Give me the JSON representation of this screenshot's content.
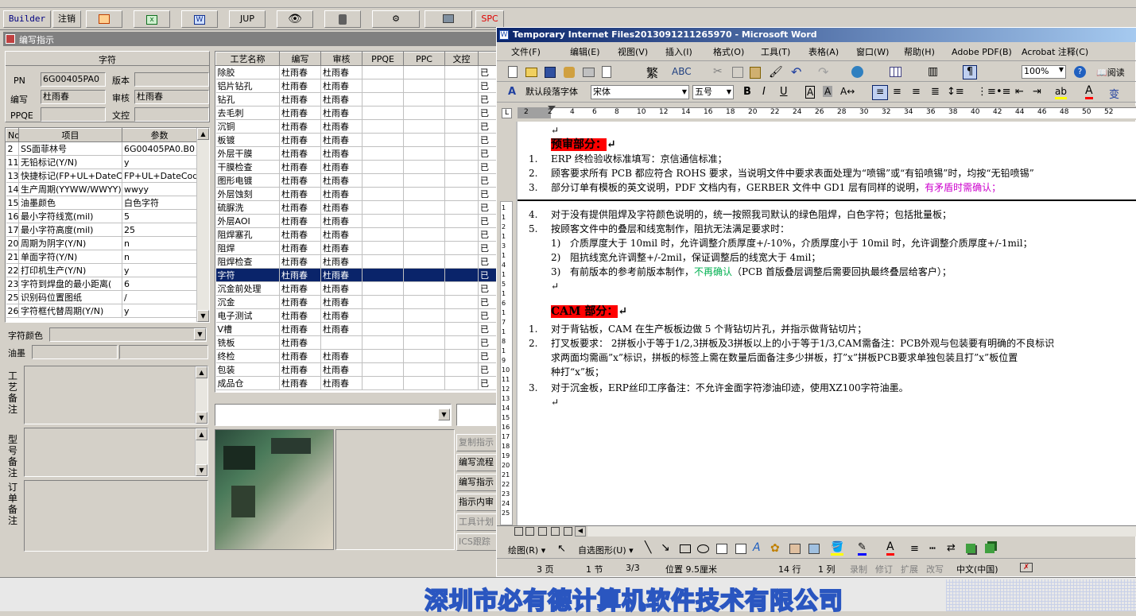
{
  "toolbar": {
    "builder": "Builder",
    "logout": "注销",
    "jup": "JUP",
    "spc": "SPC"
  },
  "panel": {
    "title": "编写指示",
    "section": "字符",
    "pn_label": "PN",
    "pn_value": "6G00405PA0",
    "version_label": "版本",
    "version_value": "",
    "author_label": "编写",
    "author_value": "杜雨春",
    "reviewer_label": "审核",
    "reviewer_value": "杜雨春",
    "ppqe_label": "PPQE",
    "ppqe_value": "",
    "doc_label": "文控",
    "doc_value": ""
  },
  "params": {
    "headers": [
      "No",
      "项目",
      "参数"
    ],
    "rows": [
      [
        "2",
        "SS面菲林号",
        "6G00405PA0.B0"
      ],
      [
        "11",
        "无铅标记(Y/N)",
        "y"
      ],
      [
        "13",
        "快捷标记(FP+UL+DateCo",
        "FP+UL+DateCode"
      ],
      [
        "14",
        "生产周期(YYWW/WWYY)",
        "wwyy"
      ],
      [
        "15",
        "油墨颜色",
        "白色字符"
      ],
      [
        "16",
        "最小字符线宽(mil)",
        "5"
      ],
      [
        "17",
        "最小字符高度(mil)",
        "25"
      ],
      [
        "20",
        "周期为阴字(Y/N)",
        "n"
      ],
      [
        "21",
        "单面字符(Y/N)",
        "n"
      ],
      [
        "22",
        "打印机生产(Y/N)",
        "y"
      ],
      [
        "23",
        "字符到焊盘的最小距离(",
        "6"
      ],
      [
        "25",
        "识别码位置图纸",
        "/"
      ],
      [
        "26",
        "字符框代替周期(Y/N)",
        "y"
      ]
    ]
  },
  "left_fields": {
    "color_label": "字符颜色",
    "ink_label": "油墨",
    "process_note": "工艺备注",
    "model_note": "型号备注",
    "order_note": "订单备注"
  },
  "processes": {
    "headers": [
      "工艺名称",
      "编写",
      "审核",
      "PPQE",
      "PPC",
      "文控"
    ],
    "rows": [
      [
        "除胶",
        "杜雨春",
        "杜雨春",
        "已"
      ],
      [
        "铝片钻孔",
        "杜雨春",
        "杜雨春",
        "已"
      ],
      [
        "钻孔",
        "杜雨春",
        "杜雨春",
        "已"
      ],
      [
        "去毛刺",
        "杜雨春",
        "杜雨春",
        "已"
      ],
      [
        "沉铜",
        "杜雨春",
        "杜雨春",
        "已"
      ],
      [
        "板镀",
        "杜雨春",
        "杜雨春",
        "已"
      ],
      [
        "外层干膜",
        "杜雨春",
        "杜雨春",
        "已"
      ],
      [
        "干膜检查",
        "杜雨春",
        "杜雨春",
        "已"
      ],
      [
        "图形电镀",
        "杜雨春",
        "杜雨春",
        "已"
      ],
      [
        "外层蚀刻",
        "杜雨春",
        "杜雨春",
        "已"
      ],
      [
        "硫脲洗",
        "杜雨春",
        "杜雨春",
        "已"
      ],
      [
        "外层AOI",
        "杜雨春",
        "杜雨春",
        "已"
      ],
      [
        "阻焊塞孔",
        "杜雨春",
        "杜雨春",
        "已"
      ],
      [
        "阻焊",
        "杜雨春",
        "杜雨春",
        "已"
      ],
      [
        "阻焊检查",
        "杜雨春",
        "杜雨春",
        "已"
      ],
      [
        "字符",
        "杜雨春",
        "杜雨春",
        "已"
      ],
      [
        "沉金前处理",
        "杜雨春",
        "杜雨春",
        "已"
      ],
      [
        "沉金",
        "杜雨春",
        "杜雨春",
        "已"
      ],
      [
        "电子测试",
        "杜雨春",
        "杜雨春",
        "已"
      ],
      [
        "V槽",
        "杜雨春",
        "杜雨春",
        "已"
      ],
      [
        "铣板",
        "杜雨春",
        "",
        "已"
      ],
      [
        "终检",
        "杜雨春",
        "杜雨春",
        "已"
      ],
      [
        "包装",
        "杜雨春",
        "杜雨春",
        "已"
      ],
      [
        "成品仓",
        "杜雨春",
        "杜雨春",
        "已"
      ]
    ]
  },
  "side_buttons": [
    "复制指示",
    "编写流程",
    "编写指示",
    "指示内审",
    "工具计划",
    "ICS跟踪"
  ],
  "word": {
    "title": "Temporary Internet Files2013091211265970 - Microsoft Word",
    "menu": [
      "文件(F)",
      "编辑(E)",
      "视图(V)",
      "插入(I)",
      "格式(O)",
      "工具(T)",
      "表格(A)",
      "窗口(W)",
      "帮助(H)",
      "Adobe PDF(B)",
      "Acrobat 注释(C)"
    ],
    "style": "默认段落字体",
    "font": "宋体",
    "size": "五号",
    "zoom": "100%",
    "read": "阅读",
    "ruler": [
      "2",
      "2",
      "4",
      "6",
      "8",
      "10",
      "12",
      "14",
      "16",
      "18",
      "20",
      "22",
      "24",
      "26",
      "28",
      "30",
      "32",
      "34",
      "36",
      "38",
      "40",
      "42",
      "44",
      "46",
      "48",
      "50",
      "52"
    ],
    "pre_title": "预审部分：",
    "pre_items": [
      {
        "n": "1.",
        "text": "ERP 终检验收标准填写：京信通信标准；"
      },
      {
        "n": "2.",
        "text": "顾客要求所有 PCB 都应符合 ROHS 要求，当说明文件中要求表面处理为“喷锡”或“有铅喷锡”时，均按“无铅喷锡”"
      },
      {
        "n": "3.",
        "text": "部分订单有模板的英文说明，PDF 文档内有，GERBER 文件中 GD1 层有同样的说明，",
        "highlight": "有矛盾时需确认；"
      },
      {
        "n": "4.",
        "text": "对于没有提供阻焊及字符颜色说明的，统一按照我司默认的绿色阻焊，白色字符；包括批量板；"
      },
      {
        "n": "5.",
        "text": "按顾客文件中的叠层和线宽制作，阻抗无法满足要求时："
      }
    ],
    "sub_items": [
      {
        "n": "1)",
        "text": "介质厚度大于 10mil 时，允许调整介质厚度+/-10%，介质厚度小于 10mil 时，允许调整介质厚度+/-1mil；"
      },
      {
        "n": "2)",
        "text": "阻抗线宽允许调整+/-2mil，保证调整后的线宽大于 4mil；"
      },
      {
        "n": "3)",
        "text": "有前版本的参考前版本制作，",
        "green": "不再确认",
        "after": "（PCB 首版叠层调整后需要回执最终叠层给客户）；"
      }
    ],
    "cam_title": "CAM 部分：",
    "cam_items": [
      {
        "n": "1.",
        "text": "对于背钻板，CAM 在生产板板边做 5 个背钻切片孔，并指示做背钻切片；"
      },
      {
        "n": "2.",
        "text": "打叉板要求：  2拼板小于等于1/2,3拼板及3拼板以上的小于等于1/3,CAM需备注：PCB外观与包装要有明确的不良标识",
        "cont1": "求两面均需画”x”标识，拼板的标签上需在数量后面备注多少拼板，打”x”拼板PCB要求单独包装且打”x”板位置",
        "cont2": "种打“x”板；"
      },
      {
        "n": "3.",
        "text": "对于沉金板，ERP丝印工序备注：不允许金面字符渗油印迹，使用XZ100字符油墨。"
      }
    ],
    "vruler": [
      "1",
      "1",
      "2",
      "1",
      "3",
      "1",
      "4",
      "1",
      "5",
      "1",
      "6",
      "1",
      "7",
      "1",
      "8",
      "1",
      "9",
      "10",
      "11",
      "12",
      "13",
      "14",
      "15",
      "16",
      "17",
      "18",
      "19",
      "20",
      "21",
      "22",
      "23",
      "24",
      "25"
    ],
    "draw_label": "绘图(R)",
    "autoshape": "自选图形(U)",
    "status": {
      "page": "3 页",
      "section": "1 节",
      "pages": "3/3",
      "pos": "位置 9.5厘米",
      "line": "14 行",
      "col": "1 列",
      "rec": "录制",
      "trk": "修订",
      "ext": "扩展",
      "ovr": "改写",
      "lang": "中文(中国)"
    }
  },
  "footer": "深圳市必有德计算机软件技术有限公司",
  "colors": {
    "selection": "#0a246a",
    "highlight_red": "#ff0000",
    "magenta": "#cc00cc",
    "green": "#00b050",
    "footer_blue": "#2a56c0"
  }
}
